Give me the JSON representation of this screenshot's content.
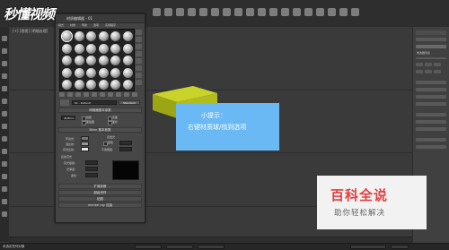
{
  "watermark_top_left": "秒懂视频",
  "material_editor": {
    "title": "材质编辑器 - 01",
    "menu": [
      "模式",
      "材质",
      "导航",
      "选项",
      "实用程序"
    ],
    "material_name": "01 - Default",
    "material_type": "Standard",
    "rollouts": {
      "shader_basic": "明暗器基本参数",
      "blinn_basic": "Blinn 基本参数",
      "extended": "扩展参数",
      "supersampling": "超级采样",
      "maps": "贴图",
      "mental_ray": "mental ray 连接"
    },
    "shader": "(B)Blinn",
    "options": [
      "线框",
      "双面",
      "面贴图",
      "面状"
    ],
    "colors": {
      "ambient_label": "环境光:",
      "diffuse_label": "漫反射:",
      "specular_label": "高光反射:",
      "self_illumination": "自发光",
      "color_label": "颜色",
      "opacity_label": "不透明度:",
      "ambient": "#777777",
      "diffuse": "#999999",
      "specular": "#e6e6e6"
    },
    "specular_highlights": {
      "title": "反射高光",
      "level_label": "高光级别:",
      "glossiness_label": "光泽度:",
      "soften_label": "柔化:"
    }
  },
  "tooltip": {
    "title": "小提示：",
    "body": "右键材质球/找到选项",
    "background": "#6ab8f4"
  },
  "viewport": {
    "label": "[+] [透视] [明暗处理]",
    "box_color": "#b7c31a"
  },
  "right_panel": {
    "header": "修改器列表"
  },
  "status": {
    "text": "未选定任何对象"
  },
  "baike_watermark": {
    "title": "百科全说",
    "subtitle": "助你轻松解决",
    "title_color": "#e23f3f"
  }
}
